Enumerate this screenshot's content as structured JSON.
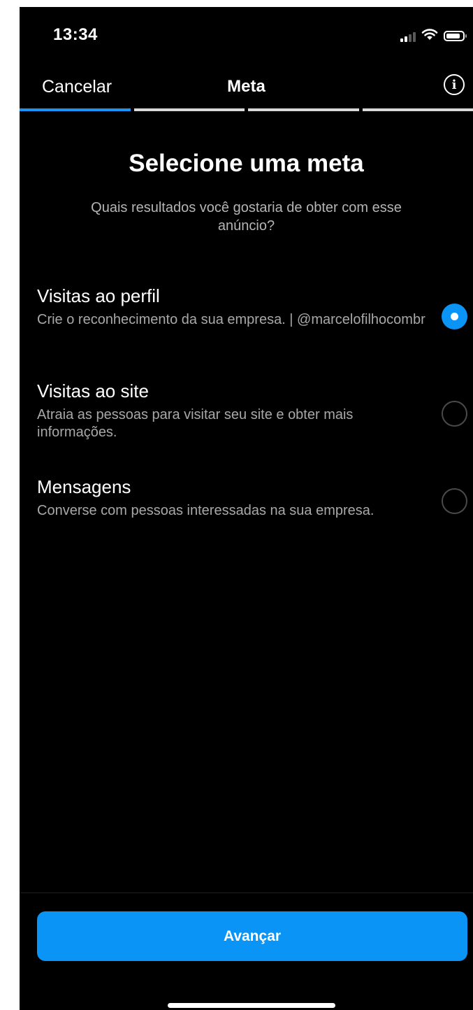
{
  "status_bar": {
    "time": "13:34",
    "icons": [
      "signal-icon",
      "wifi-icon",
      "battery-icon"
    ]
  },
  "header": {
    "cancel_label": "Cancelar",
    "title": "Meta",
    "info_icon": "info-icon",
    "progress_steps": 4,
    "progress_current": 1
  },
  "page": {
    "title": "Selecione uma meta",
    "subtitle": "Quais resultados você gostaria de obter com esse anúncio?"
  },
  "options": [
    {
      "title": "Visitas ao perfil",
      "description": "Crie o reconhecimento da sua empresa. | @marcelofilhocombr",
      "selected": true
    },
    {
      "title": "Visitas ao site",
      "description": "Atraia as pessoas para visitar seu site e obter mais informações.",
      "selected": false
    },
    {
      "title": "Mensagens",
      "description": "Converse com pessoas interessadas na sua empresa.",
      "selected": false
    }
  ],
  "footer": {
    "next_label": "Avançar"
  },
  "colors": {
    "accent": "#0a95f6",
    "background": "#000000",
    "text_secondary": "#a8a8a8"
  }
}
